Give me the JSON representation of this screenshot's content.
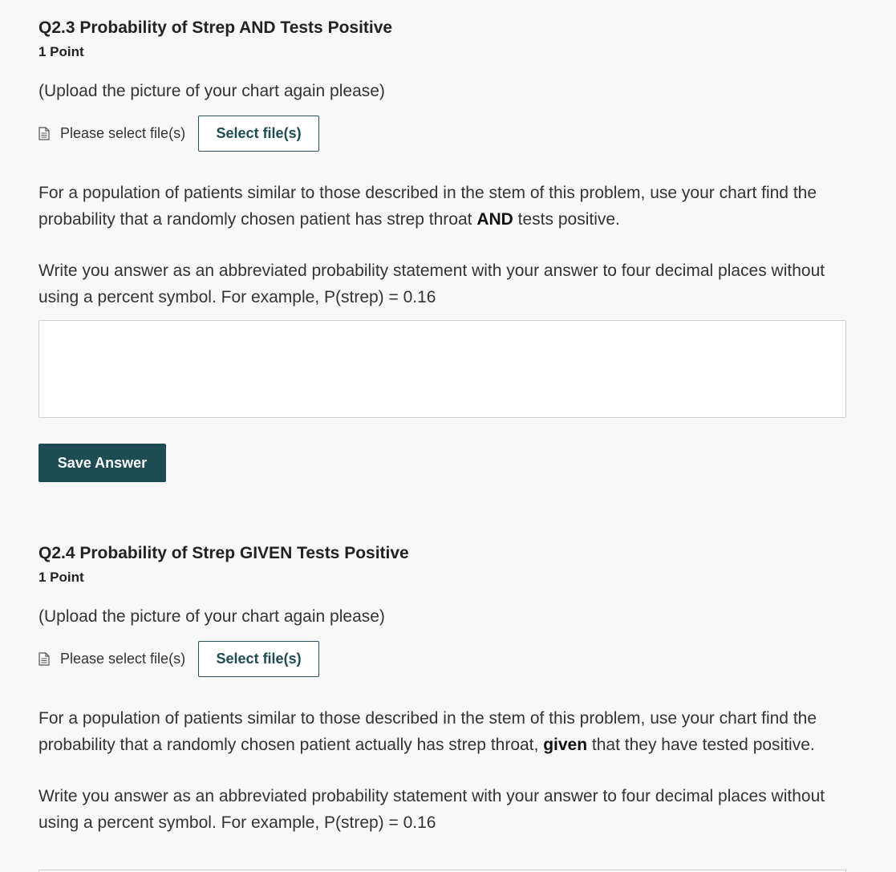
{
  "questions": [
    {
      "title": "Q2.3 Probability of Strep AND Tests Positive",
      "points": "1 Point",
      "upload_note": "(Upload the picture of your chart again please)",
      "file_hint": "Please select file(s)",
      "select_button": "Select file(s)",
      "prompt_before": "For a population of patients similar to those described in the stem of this problem, use your chart find the probability that a randomly chosen patient has strep throat ",
      "prompt_bold": "AND",
      "prompt_after": " tests positive.",
      "instructions": "Write you answer as an abbreviated probability statement with your answer to four decimal places without using a percent symbol.  For example, P(strep) = 0.16",
      "answer_value": "",
      "save_button": "Save Answer"
    },
    {
      "title": "Q2.4 Probability of Strep GIVEN Tests Positive",
      "points": "1 Point",
      "upload_note": "(Upload the picture of your chart again please)",
      "file_hint": "Please select file(s)",
      "select_button": "Select file(s)",
      "prompt_before": "For a population of patients similar to those described in the stem of this problem, use your chart find the probability that a randomly chosen patient actually has strep throat, ",
      "prompt_bold": "given",
      "prompt_after": " that they have tested positive.",
      "instructions": "Write you answer as an abbreviated probability statement with your answer to four decimal places without using a percent symbol.  For example, P(strep) = 0.16"
    }
  ],
  "icons": {
    "file": "document-icon"
  },
  "colors": {
    "background": "#f8f8f8",
    "accent": "#1d4c54",
    "border": "#cfcfcf"
  }
}
